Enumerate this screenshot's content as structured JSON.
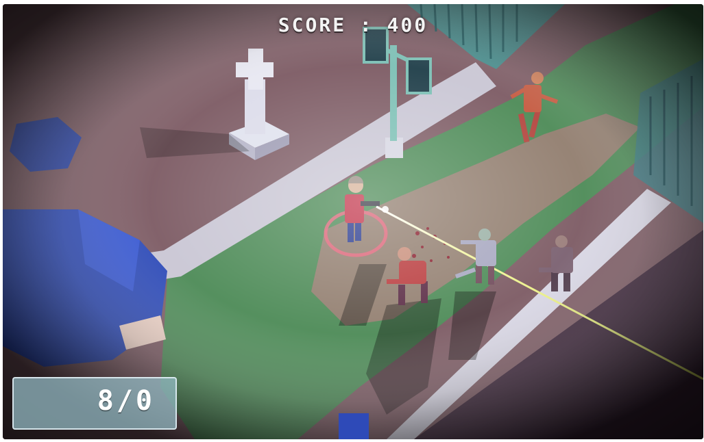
{
  "hud": {
    "score_text": "SCORE : 400",
    "ammo_text": "8/0"
  },
  "colors": {
    "ground": "#8a6a6e",
    "grass": "#4c8a56",
    "path": "#c9c6d4",
    "laser": "#e8ef7a",
    "target_ring": "#e7607a",
    "panel": "#96bec8"
  },
  "scene": {
    "player_icon": "player-gunner-icon",
    "enemy_icon": "zombie-icon",
    "zombie_count": 4
  }
}
